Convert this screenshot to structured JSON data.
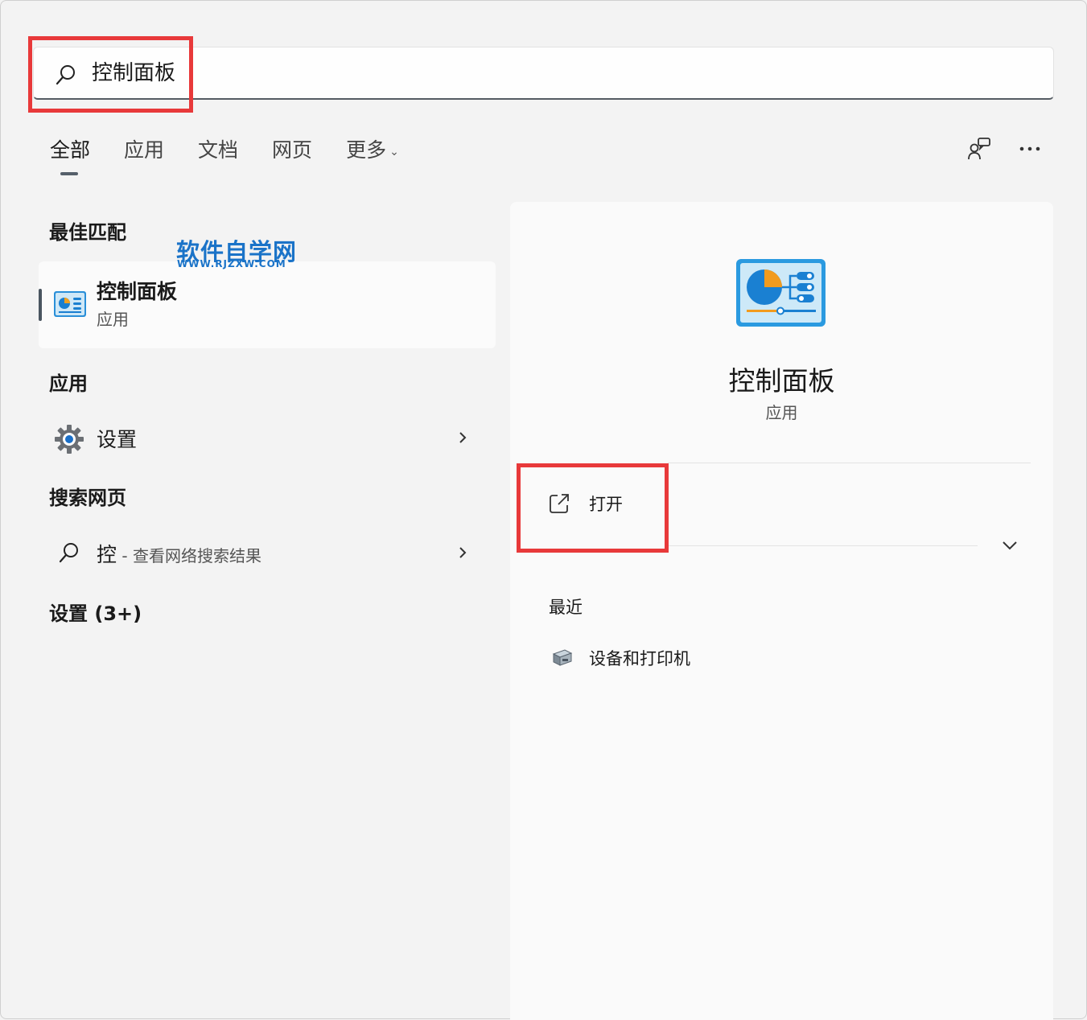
{
  "search": {
    "query": "控制面板"
  },
  "tabs": [
    {
      "label": "全部"
    },
    {
      "label": "应用"
    },
    {
      "label": "文档"
    },
    {
      "label": "网页"
    },
    {
      "label": "更多"
    }
  ],
  "watermark": {
    "cn": "软件自学网",
    "en": "WWW.RJZXW.COM"
  },
  "best_match": {
    "title": "最佳匹配",
    "name": "控制面板",
    "type": "应用"
  },
  "apps": {
    "title": "应用",
    "items": [
      {
        "label": "设置"
      }
    ]
  },
  "web": {
    "title": "搜索网页",
    "query": "控",
    "suffix": " - 查看网络搜索结果"
  },
  "settings_section": {
    "title": "设置 (3+)"
  },
  "detail": {
    "name": "控制面板",
    "type": "应用",
    "open_label": "打开",
    "recent_title": "最近",
    "recent_items": [
      {
        "label": "设备和打印机"
      }
    ]
  },
  "colors": {
    "highlight": "#e8393a",
    "watermark": "#1a73c8"
  }
}
